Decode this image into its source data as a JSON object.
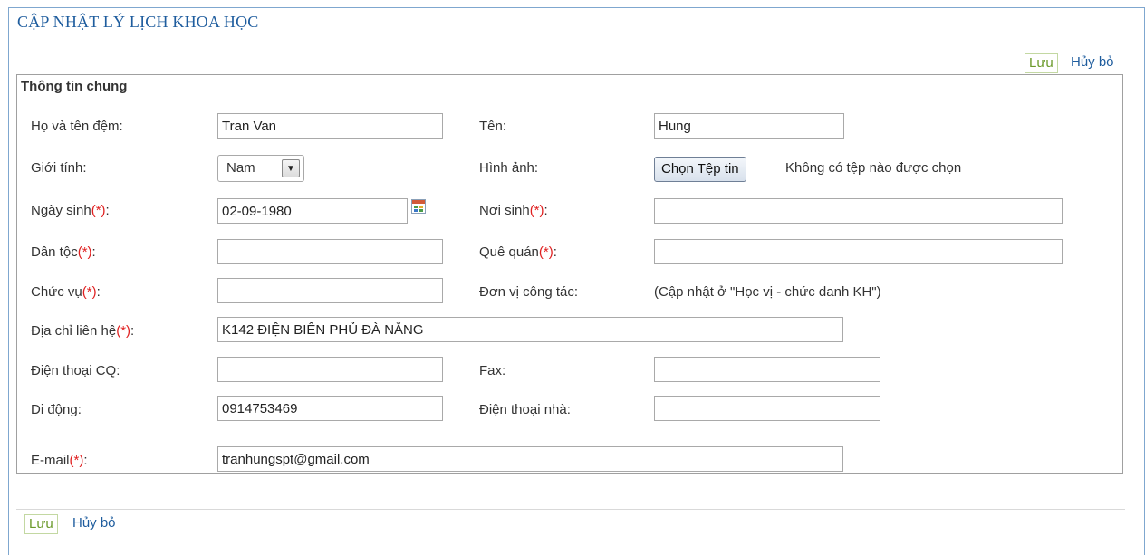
{
  "page": {
    "title": "CẬP NHẬT LÝ LỊCH KHOA HỌC"
  },
  "toolbar_top": {
    "save_label": "Lưu",
    "cancel_label": "Hủy bỏ"
  },
  "toolbar_bottom": {
    "save_label": "Lưu",
    "cancel_label": "Hủy bỏ"
  },
  "section": {
    "legend": "Thông tin chung",
    "required_mark": "(*)"
  },
  "fields": {
    "ho_ten_dem": {
      "label": "Họ và tên đệm:",
      "value": "Tran Van"
    },
    "ten": {
      "label": "Tên:",
      "value": "Hung"
    },
    "gioi_tinh": {
      "label": "Giới tính:",
      "value": "Nam"
    },
    "hinh_anh": {
      "label": "Hình ảnh:",
      "button": "Chọn Tệp tin",
      "status": "Không có tệp nào được chọn"
    },
    "ngay_sinh": {
      "label": "Ngày sinh",
      "value": "02-09-1980"
    },
    "noi_sinh": {
      "label": "Nơi sinh",
      "value": ""
    },
    "dan_toc": {
      "label": "Dân tộc",
      "value": ""
    },
    "que_quan": {
      "label": "Quê quán",
      "value": ""
    },
    "chuc_vu": {
      "label": "Chức vụ",
      "value": ""
    },
    "don_vi": {
      "label": "Đơn vị công tác:",
      "note": "(Cập nhật ở \"Học vị - chức danh KH\")"
    },
    "dia_chi": {
      "label": "Địa chỉ liên hệ",
      "value": "K142 ĐIỆN BIÊN PHỦ ĐÀ NẴNG"
    },
    "dt_cq": {
      "label": "Điện thoại CQ:",
      "value": ""
    },
    "fax": {
      "label": "Fax:",
      "value": ""
    },
    "di_dong": {
      "label": "Di động:",
      "value": "0914753469"
    },
    "dt_nha": {
      "label": "Điện thoại nhà:",
      "value": ""
    },
    "email": {
      "label": "E-mail",
      "value": "tranhungspt@gmail.com"
    }
  },
  "colors": {
    "title": "#1f5d9e",
    "save": "#6b9a2b",
    "required": "#e02020",
    "frame": "#7fa7cf"
  }
}
